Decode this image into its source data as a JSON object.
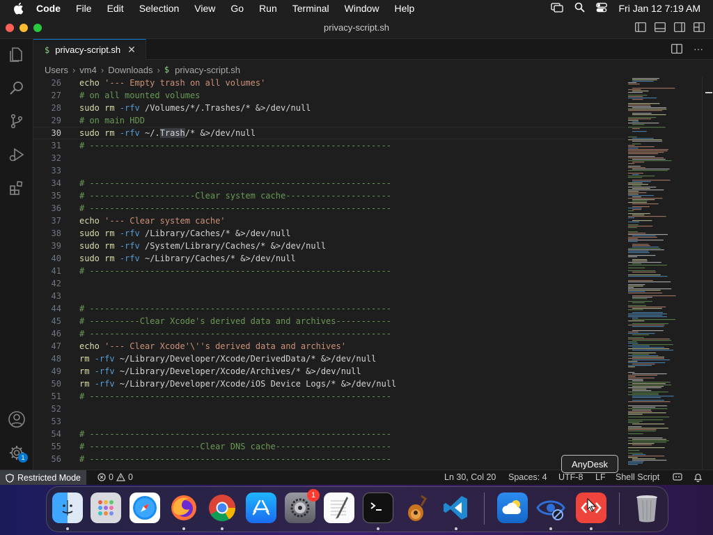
{
  "menubar": {
    "app": "Code",
    "items": [
      "File",
      "Edit",
      "Selection",
      "View",
      "Go",
      "Run",
      "Terminal",
      "Window",
      "Help"
    ],
    "clock": "Fri Jan 12  7:19 AM"
  },
  "window": {
    "title": "privacy-script.sh"
  },
  "tab": {
    "label": "privacy-script.sh"
  },
  "breadcrumb": {
    "parts": [
      "Users",
      "vm4",
      "Downloads",
      "privacy-script.sh"
    ]
  },
  "editor": {
    "current_line": 30,
    "lines": [
      {
        "n": "26",
        "t": "echo '--- Empty trash on all volumes'"
      },
      {
        "n": "27",
        "t": "# on all mounted volumes"
      },
      {
        "n": "28",
        "t": "sudo rm -rfv /Volumes/*/.Trashes/* &>/dev/null"
      },
      {
        "n": "29",
        "t": "# on main HDD"
      },
      {
        "n": "30",
        "t": "sudo rm -rfv ~/.Trash/* &>/dev/null"
      },
      {
        "n": "31",
        "t": "# ------------------------------------------------------------"
      },
      {
        "n": "32",
        "t": ""
      },
      {
        "n": "33",
        "t": ""
      },
      {
        "n": "34",
        "t": "# ------------------------------------------------------------"
      },
      {
        "n": "35",
        "t": "# ---------------------Clear system cache---------------------"
      },
      {
        "n": "36",
        "t": "# ------------------------------------------------------------"
      },
      {
        "n": "37",
        "t": "echo '--- Clear system cache'"
      },
      {
        "n": "38",
        "t": "sudo rm -rfv /Library/Caches/* &>/dev/null"
      },
      {
        "n": "39",
        "t": "sudo rm -rfv /System/Library/Caches/* &>/dev/null"
      },
      {
        "n": "40",
        "t": "sudo rm -rfv ~/Library/Caches/* &>/dev/null"
      },
      {
        "n": "41",
        "t": "# ------------------------------------------------------------"
      },
      {
        "n": "42",
        "t": ""
      },
      {
        "n": "43",
        "t": ""
      },
      {
        "n": "44",
        "t": "# ------------------------------------------------------------"
      },
      {
        "n": "45",
        "t": "# ----------Clear Xcode's derived data and archives-----------"
      },
      {
        "n": "46",
        "t": "# ------------------------------------------------------------"
      },
      {
        "n": "47",
        "t": "echo '--- Clear Xcode'\\''s derived data and archives'"
      },
      {
        "n": "48",
        "t": "rm -rfv ~/Library/Developer/Xcode/DerivedData/* &>/dev/null"
      },
      {
        "n": "49",
        "t": "rm -rfv ~/Library/Developer/Xcode/Archives/* &>/dev/null"
      },
      {
        "n": "50",
        "t": "rm -rfv ~/Library/Developer/Xcode/iOS Device Logs/* &>/dev/null"
      },
      {
        "n": "51",
        "t": "# ------------------------------------------------------------"
      },
      {
        "n": "52",
        "t": ""
      },
      {
        "n": "53",
        "t": ""
      },
      {
        "n": "54",
        "t": "# ------------------------------------------------------------"
      },
      {
        "n": "55",
        "t": "# ----------------------Clear DNS cache-----------------------"
      },
      {
        "n": "56",
        "t": "# ------------------------------------------------------------"
      }
    ]
  },
  "status": {
    "restricted": "Restricted Mode",
    "errors": "0",
    "warnings": "0",
    "position": "Ln 30, Col 20",
    "spaces": "Spaces: 4",
    "encoding": "UTF-8",
    "eol": "LF",
    "language": "Shell Script"
  },
  "accounts_badge": "1",
  "tooltip": "AnyDesk",
  "dock": {
    "apps": [
      "finder-icon",
      "launchpad-icon",
      "safari-icon",
      "firefox-icon",
      "chrome-icon",
      "app-store-icon",
      "system-settings-icon",
      "textedit-icon",
      "terminal-icon",
      "garageband-icon",
      "vscode-icon",
      "weather-icon",
      "visibility-icon",
      "anydesk-icon",
      "trash-icon"
    ],
    "settings_badge": "1"
  }
}
